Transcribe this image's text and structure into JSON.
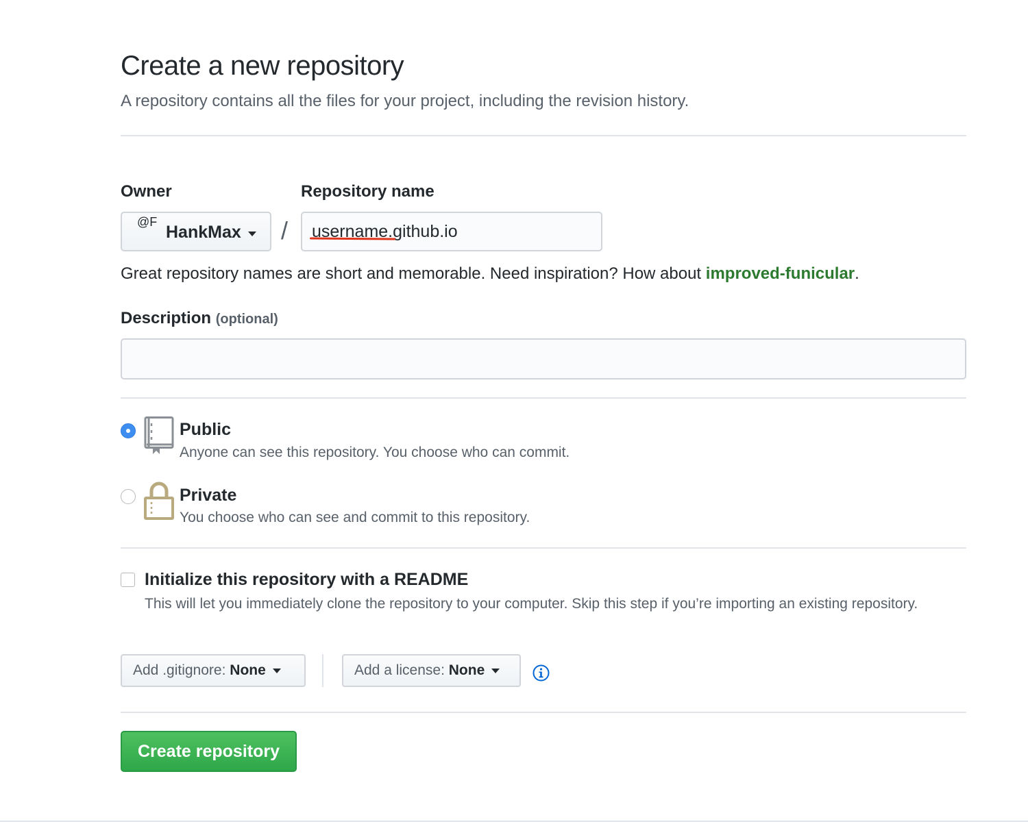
{
  "header": {
    "title": "Create a new repository",
    "subtitle": "A repository contains all the files for your project, including the revision history."
  },
  "owner": {
    "label": "Owner",
    "avatar": "@F",
    "name": "HankMax"
  },
  "repo_name": {
    "label": "Repository name",
    "value": "username.github.io"
  },
  "hint": {
    "text": "Great repository names are short and memorable. Need inspiration? How about ",
    "suggestion": "improved-funicular",
    "end": "."
  },
  "description": {
    "label": "Description",
    "optional": "(optional)",
    "value": ""
  },
  "visibility": {
    "public": {
      "title": "Public",
      "desc": "Anyone can see this repository. You choose who can commit.",
      "checked": true,
      "icon": "repo-icon"
    },
    "private": {
      "title": "Private",
      "desc": "You choose who can see and commit to this repository.",
      "checked": false,
      "icon": "lock-icon"
    }
  },
  "readme": {
    "title": "Initialize this repository with a README",
    "desc": "This will let you immediately clone the repository to your computer. Skip this step if you’re importing an existing repository.",
    "checked": false
  },
  "gitignore": {
    "prefix": "Add .gitignore:",
    "value": "None"
  },
  "license": {
    "prefix": "Add a license:",
    "value": "None"
  },
  "submit": {
    "label": "Create repository"
  },
  "colors": {
    "accent_green": "#2ea84a",
    "link_green": "#2c7a2f",
    "radio_blue": "#3d8ef0",
    "underline_red": "#e0341c"
  }
}
